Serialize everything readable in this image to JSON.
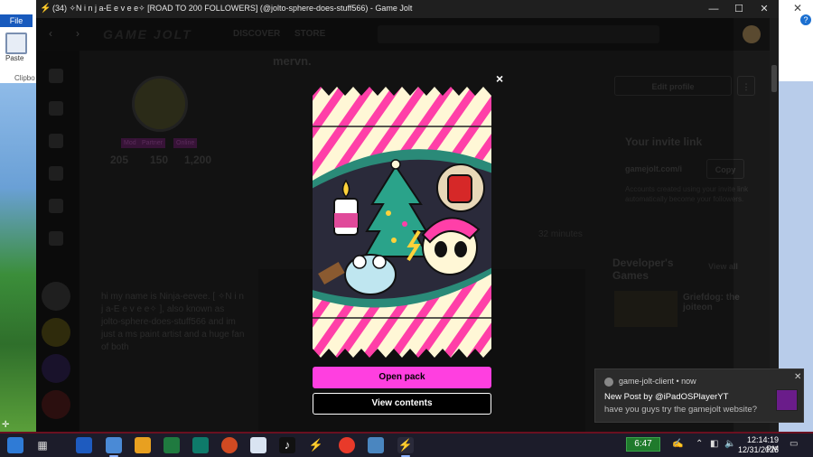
{
  "window": {
    "title": "(34) ✧N i n j a-E e v e e✧ [ROAD TO 200 FOLLOWERS] (@jolto-sphere-does-stuff566) - Game Jolt",
    "controls": [
      "—",
      "☐",
      "✕"
    ]
  },
  "background_app": {
    "file_tab": "File",
    "paste_label": "Paste",
    "clipboard_label": "Clipbo"
  },
  "nav": {
    "brand": "GAME JOLT",
    "discover": "DISCOVER",
    "store": "STORE"
  },
  "profile": {
    "tags": [
      "Mod",
      "Partner",
      "Online"
    ],
    "stats": [
      "205",
      "150",
      "1,200"
    ],
    "bio": "hi my name is Ninja-eevee. [ ✧N i n j a-E e v e e✧ ], also known as jolto-sphere-does-stuff566 and im just a ms paint artist and a huge fan of both"
  },
  "post": {
    "title": "mervn.",
    "time": "32 minutes"
  },
  "right_panel": {
    "edit_profile": "Edit profile",
    "invite_heading": "Your invite link",
    "invite_url": "gamejolt.com/i",
    "copy": "Copy",
    "invite_text": "Accounts created using your invite link automatically become your followers.",
    "dev_heading": "Developer's Games",
    "view_all": "View all",
    "game_title": "Griefdog: the joiteon"
  },
  "modal": {
    "close": "×",
    "open_pack": "Open pack",
    "view_contents": "View contents"
  },
  "toast": {
    "app": "game-jolt-client • now",
    "heading": "New Post by @iPadOSPlayerYT",
    "body": "have you guys try the gamejolt website?"
  },
  "taskbar": {
    "battery": "6:47",
    "time": "12:14:19 PM",
    "date": "12/31/2025"
  },
  "colors": {
    "accent": "#ff3fe0",
    "stripe": "#ff3fa8",
    "pack_bg": "#fff7d6",
    "teal": "#2a8a78"
  }
}
